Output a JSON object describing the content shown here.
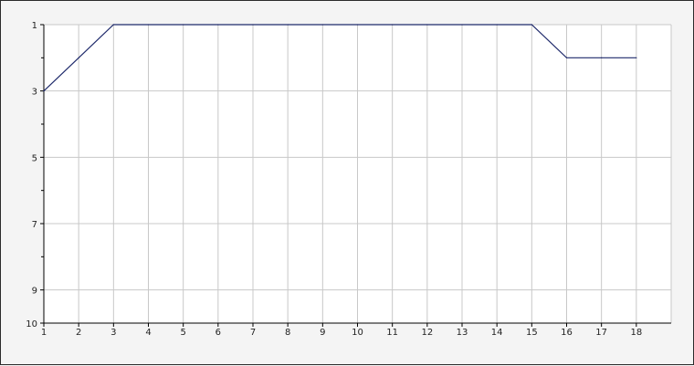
{
  "chart_data": {
    "type": "line",
    "title": "",
    "xlabel": "",
    "ylabel": "",
    "x": [
      1,
      2,
      3,
      4,
      5,
      6,
      7,
      8,
      9,
      10,
      11,
      12,
      13,
      14,
      15,
      16,
      17,
      18
    ],
    "xlim": [
      1,
      19
    ],
    "ylim": [
      1,
      10
    ],
    "y_inverted": true,
    "x_ticks": [
      1,
      2,
      3,
      4,
      5,
      6,
      7,
      8,
      9,
      10,
      11,
      12,
      13,
      14,
      15,
      16,
      17,
      18
    ],
    "y_ticks": [
      1,
      3,
      5,
      7,
      9,
      10
    ],
    "y_minor_ticks": [
      2,
      4,
      6,
      8
    ],
    "grid": true,
    "legend": "none",
    "series": [
      {
        "color": "#1f2a6b",
        "values": [
          3,
          2,
          1,
          1,
          1,
          1,
          1,
          1,
          1,
          1,
          1,
          1,
          1,
          1,
          1,
          2,
          2,
          2
        ]
      }
    ],
    "colors": {
      "background": "#f4f4f4",
      "plot_area": "#ffffff",
      "grid": "#c8c8c8",
      "axis": "#000000"
    }
  }
}
